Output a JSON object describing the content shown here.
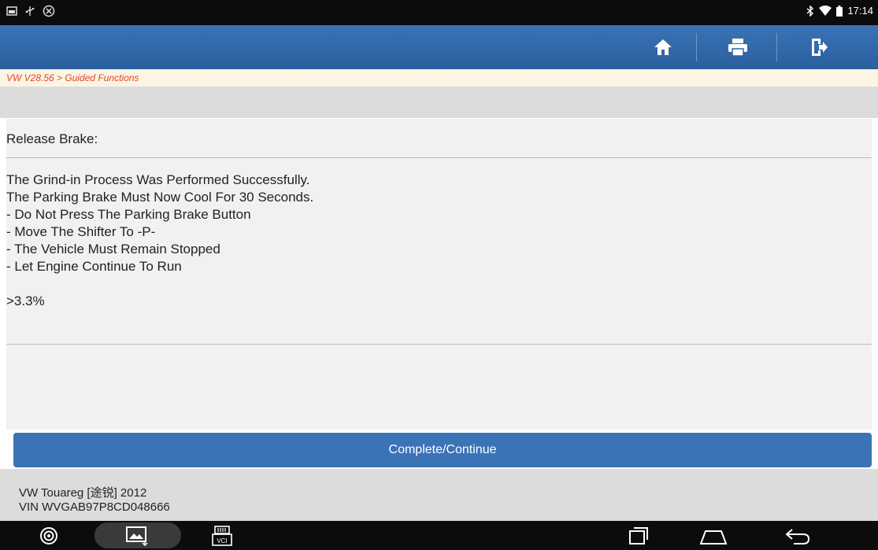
{
  "status_bar": {
    "time": "17:14",
    "left_icons": [
      "screenshot-icon",
      "usb-icon",
      "app-icon"
    ],
    "right_icons": [
      "bluetooth-icon",
      "wifi-icon",
      "battery-icon"
    ]
  },
  "toolbar": {
    "buttons": [
      "home-icon",
      "print-icon",
      "exit-icon"
    ]
  },
  "breadcrumb": {
    "text": "VW V28.56 > Guided Functions"
  },
  "panel": {
    "title": "Release Brake:",
    "lines": [
      "The Grind-in Process Was Performed Successfully.",
      "The Parking Brake Must Now Cool For 30 Seconds.",
      "- Do Not Press The Parking Brake Button",
      "- Move The Shifter To -P-",
      "- The Vehicle Must Remain Stopped",
      "- Let Engine Continue To Run"
    ],
    "progress": ">3.3%"
  },
  "actions": {
    "continue_label": "Complete/Continue"
  },
  "vehicle": {
    "model": "VW Touareg [途锐] 2012",
    "vin": "VIN WVGAB97P8CD048666"
  },
  "nav_bar": {
    "icons": [
      "launcher-icon",
      "gallery-icon",
      "vci-icon",
      "recent-apps-icon",
      "home-nav-icon",
      "back-icon"
    ],
    "vci_label": "VCI"
  },
  "colors": {
    "toolbar": "#3a73b6",
    "breadcrumb_text": "#e2442a",
    "breadcrumb_bg": "#fbf5e4",
    "panel_bg": "#f1f1f1"
  }
}
